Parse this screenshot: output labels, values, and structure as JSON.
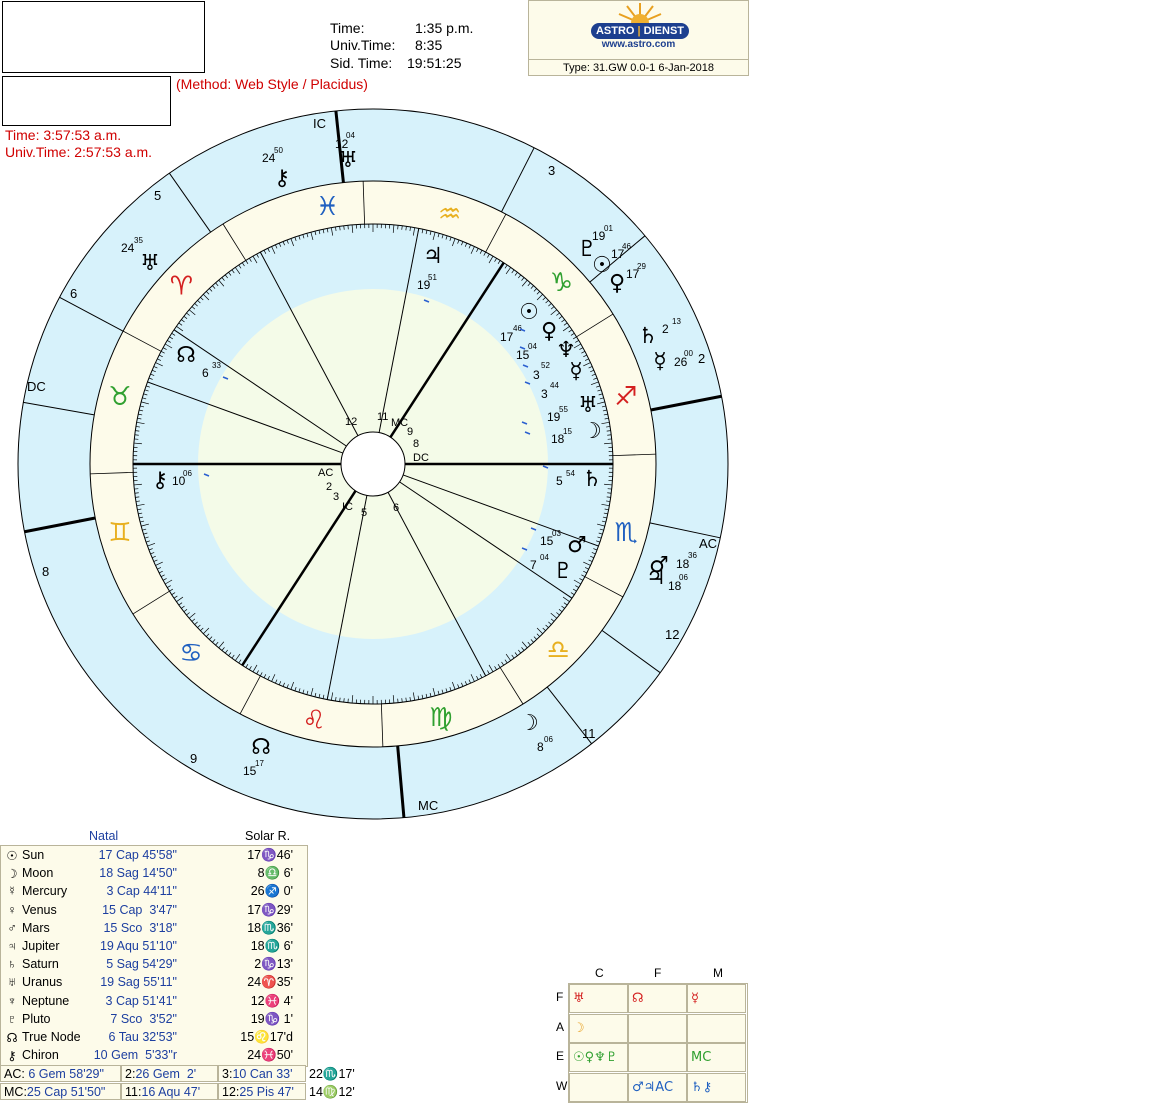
{
  "header": {
    "time_label": "Time:",
    "time_value": "1:35 p.m.",
    "univ_label": "Univ.Time:",
    "univ_value": "8:35",
    "sid_label": "Sid. Time:",
    "sid_value": "19:51:25",
    "method": "(Method: Web Style / Placidus)",
    "sr_time": "Time:  3:57:53 a.m.",
    "sr_univ": "Univ.Time:  2:57:53 a.m.",
    "logo_left": "ASTRO",
    "logo_right": "DIENST",
    "logo_url": "www.astro.com",
    "type_line": "Type: 31.GW   0.0-1   6-Jan-2018"
  },
  "colors": {
    "sky": "#d7f2fb",
    "cream": "#fdfbea",
    "blue_text": "#1d3fa0",
    "red_text": "#d00000",
    "fire": "#d42020",
    "air": "#e8b020",
    "earth": "#30a030",
    "water": "#2060c0"
  },
  "wheel": {
    "natal_angles": {
      "AC": "AC",
      "DC": "DC",
      "MC": "MC",
      "IC": "IC"
    },
    "solar_angles": {
      "AC": "AC",
      "DC": "DC",
      "MC": "MC",
      "IC": "IC"
    },
    "zodiac_signs": [
      "aries",
      "taurus",
      "gemini",
      "cancer",
      "leo",
      "virgo",
      "libra",
      "scorpio",
      "sagittarius",
      "capricorn",
      "aquarius",
      "pisces"
    ],
    "natal_house_labels": [
      "2",
      "3",
      "5",
      "6",
      "8",
      "9",
      "11",
      "12"
    ],
    "solar_house_labels": [
      "2",
      "3",
      "5",
      "6",
      "8",
      "9",
      "11",
      "12"
    ],
    "outer_planets": [
      {
        "glyph": "♅",
        "deg": "12",
        "min": "04",
        "name": "uranus-outer"
      },
      {
        "glyph": "⚷",
        "deg": "24",
        "min": "50",
        "name": "chiron-outer"
      },
      {
        "glyph": "♅",
        "deg": "24",
        "min": "35",
        "name": "uranus-outer-2"
      },
      {
        "glyph": "♇",
        "deg": "19",
        "min": "01",
        "name": "pluto-outer"
      },
      {
        "glyph": "☉",
        "deg": "17",
        "min": "46",
        "name": "sun-outer"
      },
      {
        "glyph": "♀",
        "deg": "17",
        "min": "29",
        "name": "venus-outer"
      },
      {
        "glyph": "♄",
        "deg": "2",
        "min": "13",
        "name": "saturn-outer"
      },
      {
        "glyph": "☿",
        "deg": "26",
        "min": "00",
        "name": "mercury-outer"
      },
      {
        "glyph": "♂",
        "deg": "18",
        "min": "36",
        "name": "mars-outer"
      },
      {
        "glyph": "♃",
        "deg": "18",
        "min": "06",
        "name": "jupiter-outer"
      },
      {
        "glyph": "☽",
        "deg": "8",
        "min": "06",
        "name": "moon-outer"
      },
      {
        "glyph": "☊",
        "deg": "15",
        "min": "17",
        "name": "node-outer"
      }
    ],
    "inner_planets": [
      {
        "glyph": "♃",
        "deg": "19",
        "min": "51",
        "name": "jupiter-inner"
      },
      {
        "glyph": "☊",
        "deg": "6",
        "min": "33",
        "name": "node-inner"
      },
      {
        "glyph": "☉",
        "deg": "17",
        "min": "46",
        "name": "sun-inner"
      },
      {
        "glyph": "♀",
        "deg": "15",
        "min": "04",
        "name": "venus-inner"
      },
      {
        "glyph": "♆",
        "deg": "3",
        "min": "52",
        "name": "neptune-inner"
      },
      {
        "glyph": "☿",
        "deg": "3",
        "min": "44",
        "name": "mercury-inner"
      },
      {
        "glyph": "♅",
        "deg": "19",
        "min": "55",
        "name": "uranus-inner"
      },
      {
        "glyph": "☽",
        "deg": "18",
        "min": "15",
        "name": "moon-inner"
      },
      {
        "glyph": "♄",
        "deg": "5",
        "min": "54",
        "name": "saturn-inner"
      },
      {
        "glyph": "♂",
        "deg": "15",
        "min": "03",
        "name": "mars-inner"
      },
      {
        "glyph": "♇",
        "deg": "7",
        "min": "04",
        "name": "pluto-inner"
      },
      {
        "glyph": "⚷",
        "deg": "10",
        "min": "06",
        "name": "chiron-inner"
      }
    ]
  },
  "table": {
    "col_natal": "Natal",
    "col_solar": "Solar R.",
    "rows": [
      {
        "glyph": "☉",
        "name": "Sun",
        "natal": "17 Cap 45'58\"",
        "solar": "17♑46'"
      },
      {
        "glyph": "☽",
        "name": "Moon",
        "natal": "18 Sag 14'50\"",
        "solar": "8♎ 6'"
      },
      {
        "glyph": "☿",
        "name": "Mercury",
        "natal": "3 Cap 44'11\"",
        "solar": "26♐ 0'"
      },
      {
        "glyph": "♀",
        "name": "Venus",
        "natal": "15 Cap  3'47\"",
        "solar": "17♑29'"
      },
      {
        "glyph": "♂",
        "name": "Mars",
        "natal": "15 Sco  3'18\"",
        "solar": "18♏36'"
      },
      {
        "glyph": "♃",
        "name": "Jupiter",
        "natal": "19 Aqu 51'10\"",
        "solar": "18♏ 6'"
      },
      {
        "glyph": "♄",
        "name": "Saturn",
        "natal": "5 Sag 54'29\"",
        "solar": "2♑13'"
      },
      {
        "glyph": "♅",
        "name": "Uranus",
        "natal": "19 Sag 55'11\"",
        "solar": "24♈35'"
      },
      {
        "glyph": "♆",
        "name": "Neptune",
        "natal": "3 Cap 51'41\"",
        "solar": "12♓ 4'"
      },
      {
        "glyph": "♇",
        "name": "Pluto",
        "natal": "7 Sco  3'52\"",
        "solar": "19♑ 1'"
      },
      {
        "glyph": "☊",
        "name": "True Node",
        "natal": "6 Tau 32'53\"",
        "solar": "15♌17'd"
      },
      {
        "glyph": "⚷",
        "name": "Chiron",
        "natal": "10 Gem  5'33\"r",
        "solar": "24♓50'"
      }
    ],
    "houses_row1": {
      "a_label": "AC:",
      "a_val": " 6 Gem 58'29\"",
      "b_label": "2:",
      "b_val": "26 Gem  2'",
      "c_label": "3:",
      "c_val": "10 Can 33'",
      "d": "22♏17'"
    },
    "houses_row2": {
      "a_label": "MC:",
      "a_val": "25 Cap 51'50\"",
      "b_label": "11:",
      "b_val": "16 Aqu 47'",
      "c_label": "12:",
      "c_val": "25 Pis 47'",
      "d": "14♍12'"
    }
  },
  "elements": {
    "cols": [
      "C",
      "F",
      "M"
    ],
    "rows": [
      "F",
      "A",
      "E",
      "W"
    ],
    "cells": [
      [
        "♅",
        "☊",
        "☿"
      ],
      [
        "☽",
        "",
        ""
      ],
      [
        "☉♀♆♇",
        "",
        "MC"
      ],
      [
        "",
        "♂♃AC",
        "♄⚷"
      ]
    ]
  }
}
